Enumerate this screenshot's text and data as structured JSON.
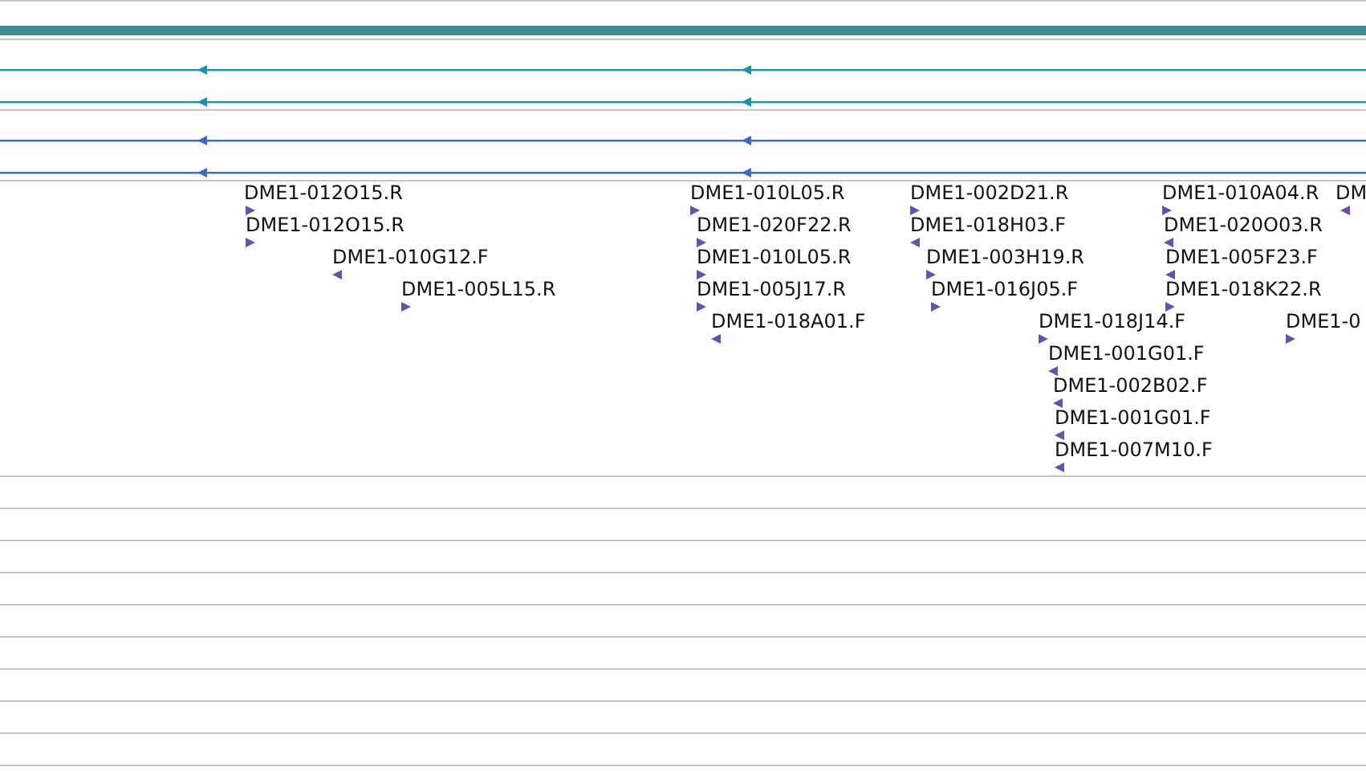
{
  "tracks": [
    {
      "color": "#1993b0"
    },
    {
      "color": "#1993b0"
    },
    {
      "color": "#3a6ac6"
    },
    {
      "color": "#3a6ac6"
    }
  ],
  "features": [
    {
      "label": "DME1-012O15.R",
      "reverse": false
    },
    {
      "label": "DME1-012O15.R",
      "reverse": false
    },
    {
      "label": "DME1-010G12.F",
      "reverse": true
    },
    {
      "label": "DME1-005L15.R",
      "reverse": false
    },
    {
      "label": "DME1-010L05.R",
      "reverse": false
    },
    {
      "label": "DME1-020F22.R",
      "reverse": false
    },
    {
      "label": "DME1-010L05.R",
      "reverse": false
    },
    {
      "label": "DME1-005J17.R",
      "reverse": false
    },
    {
      "label": "DME1-018A01.F",
      "reverse": true
    },
    {
      "label": "DME1-002D21.R",
      "reverse": false
    },
    {
      "label": "DME1-018H03.F",
      "reverse": true
    },
    {
      "label": "DME1-003H19.R",
      "reverse": false
    },
    {
      "label": "DME1-016J05.F",
      "reverse": false
    },
    {
      "label": "DME1-018J14.F",
      "reverse": false
    },
    {
      "label": "DME1-001G01.F",
      "reverse": true
    },
    {
      "label": "DME1-002B02.F",
      "reverse": true
    },
    {
      "label": "DME1-001G01.F",
      "reverse": true
    },
    {
      "label": "DME1-007M10.F",
      "reverse": true
    },
    {
      "label": "DME1-010A04.R",
      "reverse": false
    },
    {
      "label": "DME1-020O03.R",
      "reverse": true
    },
    {
      "label": "DME1-005F23.F",
      "reverse": true
    },
    {
      "label": "DME1-018K22.R",
      "reverse": false
    },
    {
      "label": "DM",
      "reverse": true
    },
    {
      "label": "DME1-0",
      "reverse": false
    }
  ]
}
